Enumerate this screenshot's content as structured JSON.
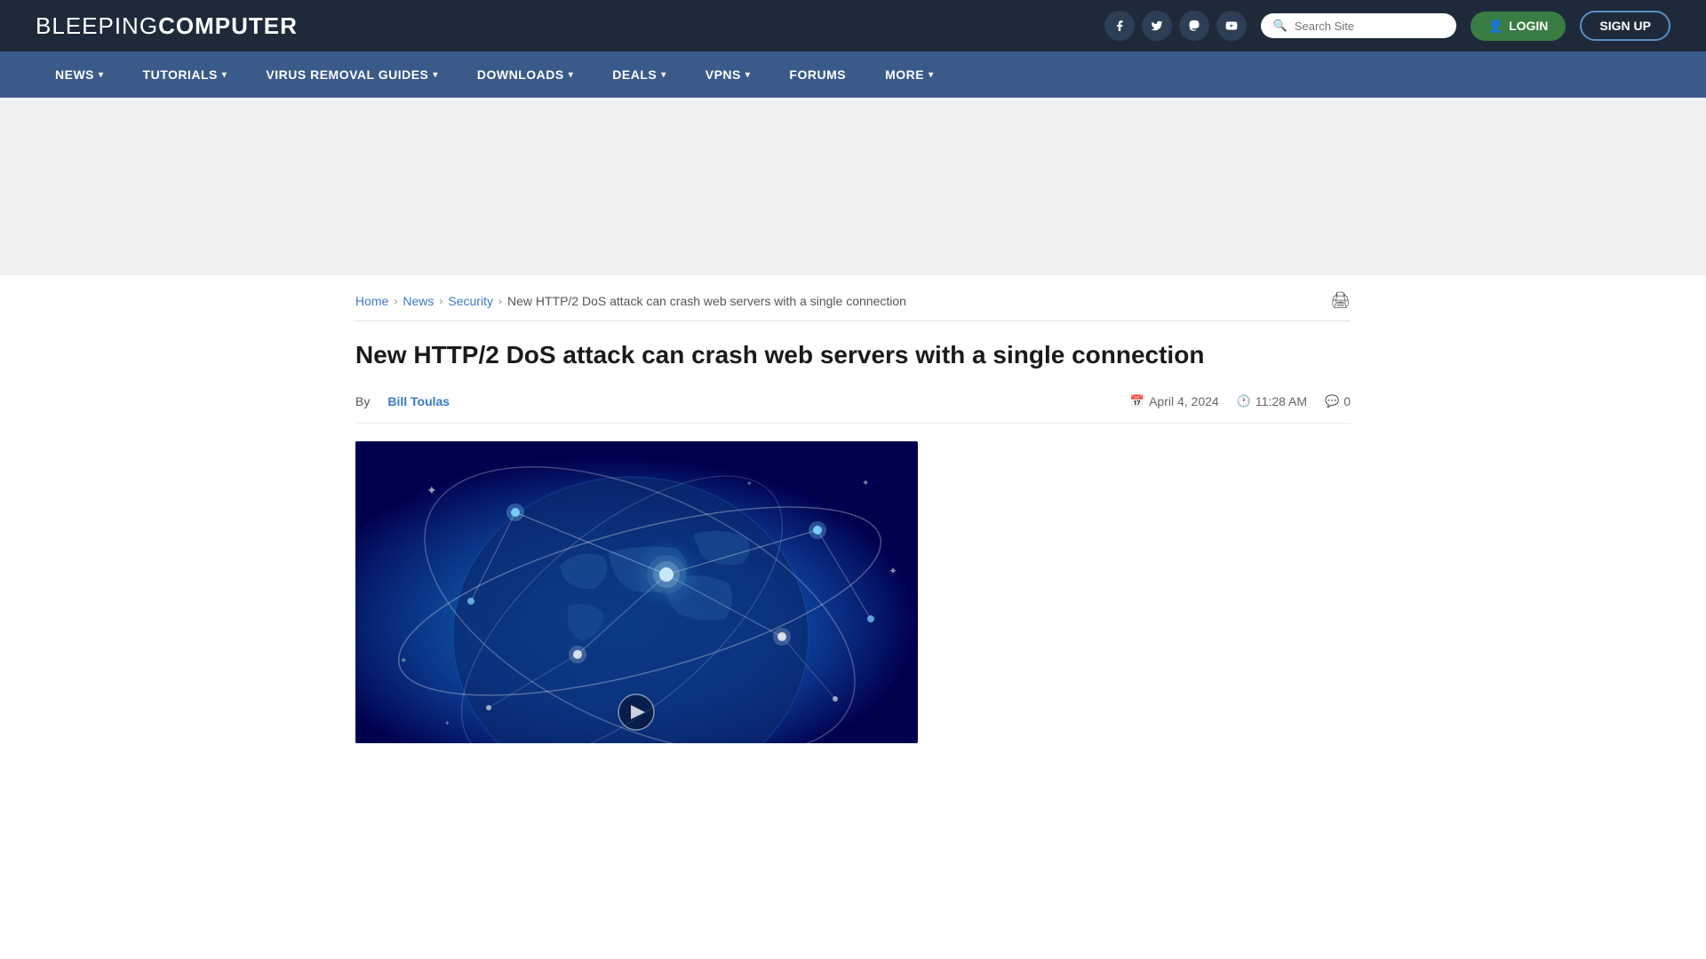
{
  "header": {
    "logo_light": "BLEEPING",
    "logo_bold": "COMPUTER",
    "social": [
      {
        "name": "facebook",
        "icon": "f"
      },
      {
        "name": "twitter",
        "icon": "𝕏"
      },
      {
        "name": "mastodon",
        "icon": "m"
      },
      {
        "name": "youtube",
        "icon": "▶"
      }
    ],
    "search_placeholder": "Search Site",
    "login_label": "LOGIN",
    "signup_label": "SIGN UP"
  },
  "nav": {
    "items": [
      {
        "label": "NEWS",
        "has_dropdown": true
      },
      {
        "label": "TUTORIALS",
        "has_dropdown": true
      },
      {
        "label": "VIRUS REMOVAL GUIDES",
        "has_dropdown": true
      },
      {
        "label": "DOWNLOADS",
        "has_dropdown": true
      },
      {
        "label": "DEALS",
        "has_dropdown": true
      },
      {
        "label": "VPNS",
        "has_dropdown": true
      },
      {
        "label": "FORUMS",
        "has_dropdown": false
      },
      {
        "label": "MORE",
        "has_dropdown": true
      }
    ]
  },
  "breadcrumb": {
    "items": [
      {
        "label": "Home",
        "href": "#"
      },
      {
        "label": "News",
        "href": "#"
      },
      {
        "label": "Security",
        "href": "#"
      }
    ],
    "current": "New HTTP/2 DoS attack can crash web servers with a single connection"
  },
  "article": {
    "title": "New HTTP/2 DoS attack can crash web servers with a single connection",
    "by_label": "By",
    "author": "Bill Toulas",
    "date": "April 4, 2024",
    "time": "11:28 AM",
    "comments": "0"
  }
}
